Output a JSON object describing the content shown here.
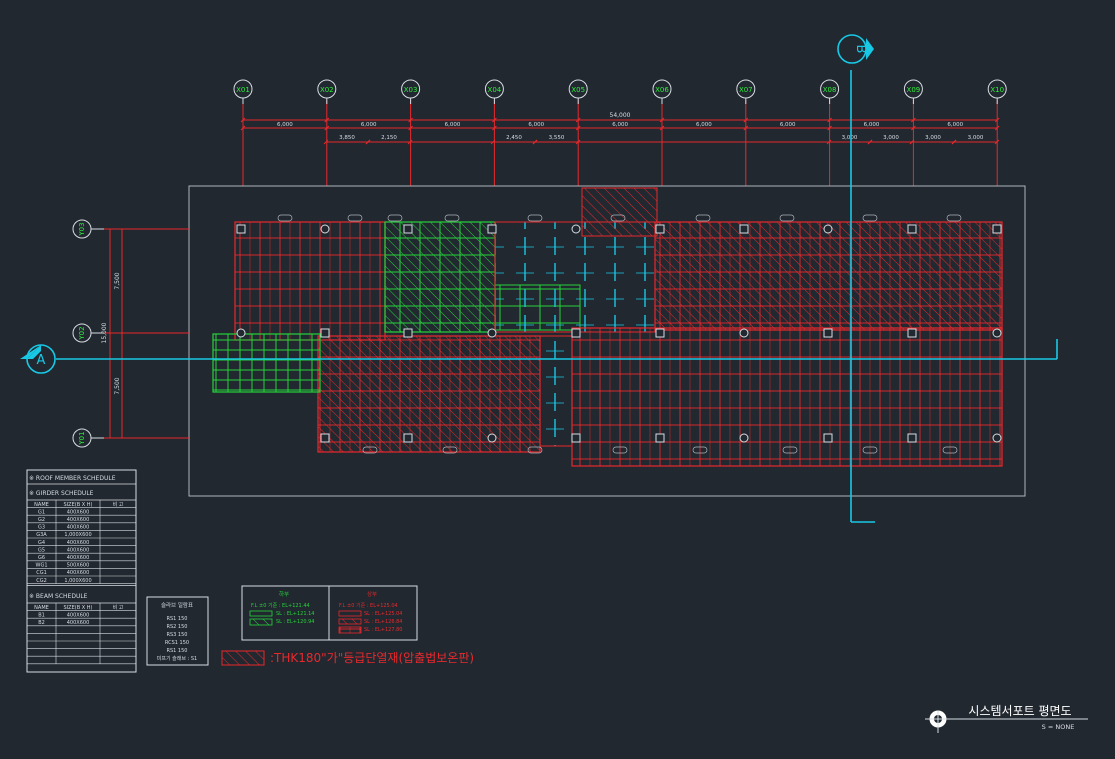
{
  "drawing": {
    "title": "시스템서포트 평면도",
    "scale": "S = NONE"
  },
  "grid_x": [
    "X01",
    "X02",
    "X03",
    "X04",
    "X05",
    "X06",
    "X07",
    "X08",
    "X09",
    "X10"
  ],
  "grid_y": [
    "Y03",
    "Y02",
    "Y01"
  ],
  "section_markers": {
    "a": "A",
    "b": "B"
  },
  "dims_top": {
    "total": "54,000",
    "row2": [
      "6,000",
      "6,000",
      "6,000",
      "6,000",
      "6,000",
      "6,000",
      "6,000",
      "6,000",
      "6,000"
    ],
    "row3": [
      "3,850",
      "2,150",
      "2,450",
      "3,550",
      "3,000",
      "3,000",
      "3,000",
      "3,000"
    ]
  },
  "dims_left": {
    "total": "15,000",
    "upper": "7,500",
    "lower": "7,500"
  },
  "roof_schedule": {
    "title": "※ ROOF MEMBER SCHEDULE",
    "girder_title": "※ GIRDER SCHEDULE",
    "headers": [
      "NAME",
      "SIZE(B X H)",
      "비  고"
    ],
    "girders": [
      [
        "G1",
        "400X600",
        ""
      ],
      [
        "G2",
        "400X600",
        ""
      ],
      [
        "G3",
        "400X600",
        ""
      ],
      [
        "G3A",
        "1,000X600",
        ""
      ],
      [
        "G4",
        "400X600",
        ""
      ],
      [
        "G5",
        "400X600",
        ""
      ],
      [
        "G6",
        "400X600",
        ""
      ],
      [
        "WG1",
        "500X600",
        ""
      ],
      [
        "CG1",
        "400X600",
        ""
      ],
      [
        "CG2",
        "1,000X600",
        ""
      ]
    ],
    "beam_title": "※ BEAM SCHEDULE",
    "beams": [
      [
        "B1",
        "400X600",
        ""
      ],
      [
        "B2",
        "400X600",
        ""
      ],
      [
        "",
        "",
        ""
      ],
      [
        "",
        "",
        ""
      ],
      [
        "",
        "",
        ""
      ],
      [
        "",
        "",
        ""
      ],
      [
        "",
        "",
        ""
      ]
    ]
  },
  "slab_box": {
    "title": "슬라브 일람표",
    "lines": [
      "RS1  150",
      "RS2  150",
      "RS3  150",
      "RCS1  150",
      "RS1  150",
      "미프기 슬래브 : S1"
    ]
  },
  "level_legend": {
    "left_title": "하부",
    "left_lines": [
      "F.L ±0 기준 : EL+121.44",
      "SL : EL+121.14",
      "SL : EL+120.94"
    ],
    "right_title": "상부",
    "right_lines": [
      "F.L ±0 기준 : EL+125.04",
      "SL : EL+125.04",
      "SL : EL+126.84",
      "SL : EL+127.80"
    ]
  },
  "insulation_note": ":THK180\"가\"등급단열재(압출법보온판)",
  "colors": {
    "background": "#212830",
    "red": "#e8292c",
    "green": "#27d23a",
    "cyan": "#18c9e6",
    "white": "#d8dde2",
    "grid_bubble_text": "#2ef03a"
  }
}
